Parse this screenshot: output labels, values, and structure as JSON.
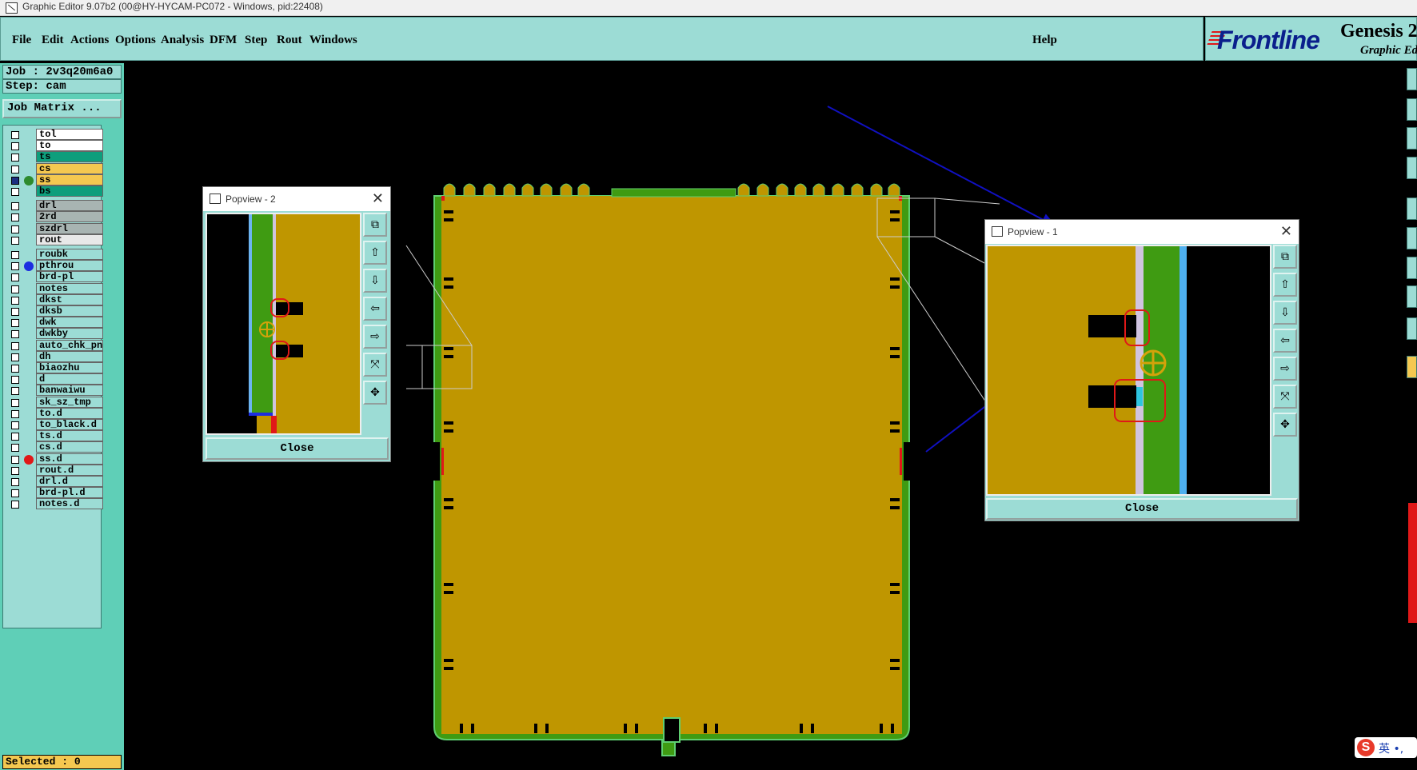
{
  "window": {
    "title": "Graphic Editor 9.07b2 (00@HY-HYCAM-PC072 - Windows, pid:22408)"
  },
  "menu": {
    "items": [
      "File",
      "Edit",
      "Actions",
      "Options",
      "Analysis",
      "DFM",
      "Step",
      "Rout",
      "Windows"
    ],
    "help": "Help"
  },
  "brand": {
    "logo": "Frontline",
    "product": "Genesis 2",
    "subtitle": "Graphic Edi"
  },
  "job": {
    "job_label": "Job : 2v3q20m6a0",
    "step_label": "Step: cam",
    "matrix_button": "Job Matrix ..."
  },
  "layers": [
    {
      "name": "tol",
      "bg": "#ffffff"
    },
    {
      "name": "to",
      "bg": "#ffffff"
    },
    {
      "name": "ts",
      "bg": "#0e9e7c"
    },
    {
      "name": "cs",
      "bg": "#f4c850"
    },
    {
      "name": "ss",
      "bg": "#f4c850",
      "dot": "#2e8b2e",
      "active": true,
      "mark": "▪"
    },
    {
      "name": "bs",
      "bg": "#0e9e7c"
    },
    {
      "name": "drl",
      "bg": "#a8b4b2",
      "gap": true
    },
    {
      "name": "2rd",
      "bg": "#a8b4b2"
    },
    {
      "name": "szdrl",
      "bg": "#a8b4b2"
    },
    {
      "name": "rout",
      "bg": "#e8e8e8"
    },
    {
      "name": "roubk",
      "bg": "#9cdcd5",
      "gap": true
    },
    {
      "name": "pthrou",
      "bg": "#9cdcd5",
      "dot": "#1c2ee0"
    },
    {
      "name": "brd-pl",
      "bg": "#9cdcd5"
    },
    {
      "name": "notes",
      "bg": "#9cdcd5"
    },
    {
      "name": "dkst",
      "bg": "#9cdcd5"
    },
    {
      "name": "dksb",
      "bg": "#9cdcd5"
    },
    {
      "name": "dwk",
      "bg": "#9cdcd5"
    },
    {
      "name": "dwkby",
      "bg": "#9cdcd5"
    },
    {
      "name": "auto_chk_pn",
      "bg": "#9cdcd5"
    },
    {
      "name": "dh",
      "bg": "#9cdcd5"
    },
    {
      "name": "biaozhu",
      "bg": "#9cdcd5"
    },
    {
      "name": "d",
      "bg": "#9cdcd5"
    },
    {
      "name": "banwaiwu",
      "bg": "#9cdcd5"
    },
    {
      "name": "sk_sz_tmp",
      "bg": "#9cdcd5"
    },
    {
      "name": "to.d",
      "bg": "#9cdcd5"
    },
    {
      "name": "to_black.d",
      "bg": "#9cdcd5"
    },
    {
      "name": "ts.d",
      "bg": "#9cdcd5"
    },
    {
      "name": "cs.d",
      "bg": "#9cdcd5",
      "mark": "✎"
    },
    {
      "name": "ss.d",
      "bg": "#9cdcd5",
      "dot": "#e01818",
      "mark": "✎"
    },
    {
      "name": "rout.d",
      "bg": "#9cdcd5"
    },
    {
      "name": "drl.d",
      "bg": "#9cdcd5"
    },
    {
      "name": "brd-pl.d",
      "bg": "#9cdcd5"
    },
    {
      "name": "notes.d",
      "bg": "#9cdcd5"
    }
  ],
  "status": {
    "selected": "Selected : 0"
  },
  "popview2": {
    "title": "Popview - 2",
    "close": "Close"
  },
  "popview1": {
    "title": "Popview - 1",
    "close": "Close"
  },
  "popview_tools": [
    "zoom-window-icon",
    "pan-up-icon",
    "pan-down-icon",
    "pan-left-icon",
    "pan-right-icon",
    "zoom-out-icon",
    "zoom-in-icon"
  ],
  "ime": {
    "label": "英 •,"
  },
  "colors": {
    "copper": "#bf9600",
    "mask_green": "#3f9b12",
    "outline_green": "#5fcf70",
    "panel": "#9cdcd5",
    "canvas": "#000000",
    "highlight_red": "#e01818",
    "arrow_blue": "#1010c0"
  }
}
